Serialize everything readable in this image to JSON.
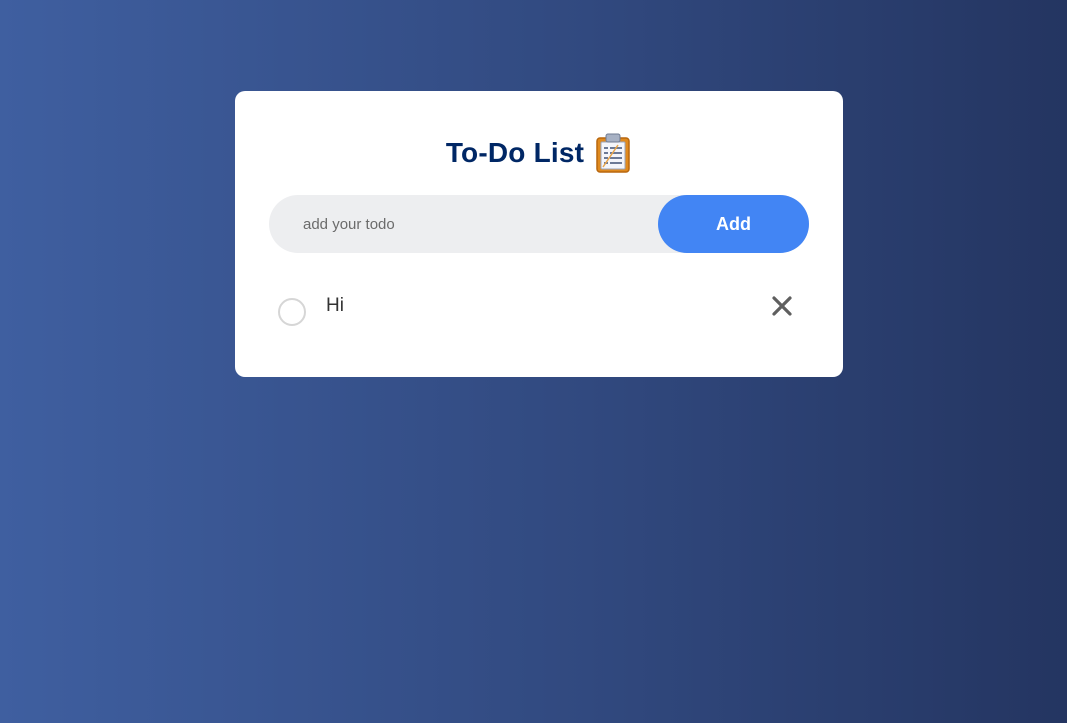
{
  "header": {
    "title": "To-Do List",
    "title_icon": "clipboard-icon"
  },
  "input": {
    "placeholder": "add your todo",
    "value": "",
    "add_label": "Add"
  },
  "todos": [
    {
      "text": "Hi",
      "checked": false,
      "delete_icon": "close-icon"
    }
  ],
  "colors": {
    "title": "#002765",
    "accent": "#4285f4",
    "input_bg": "#edeef0",
    "card_bg": "#ffffff"
  }
}
